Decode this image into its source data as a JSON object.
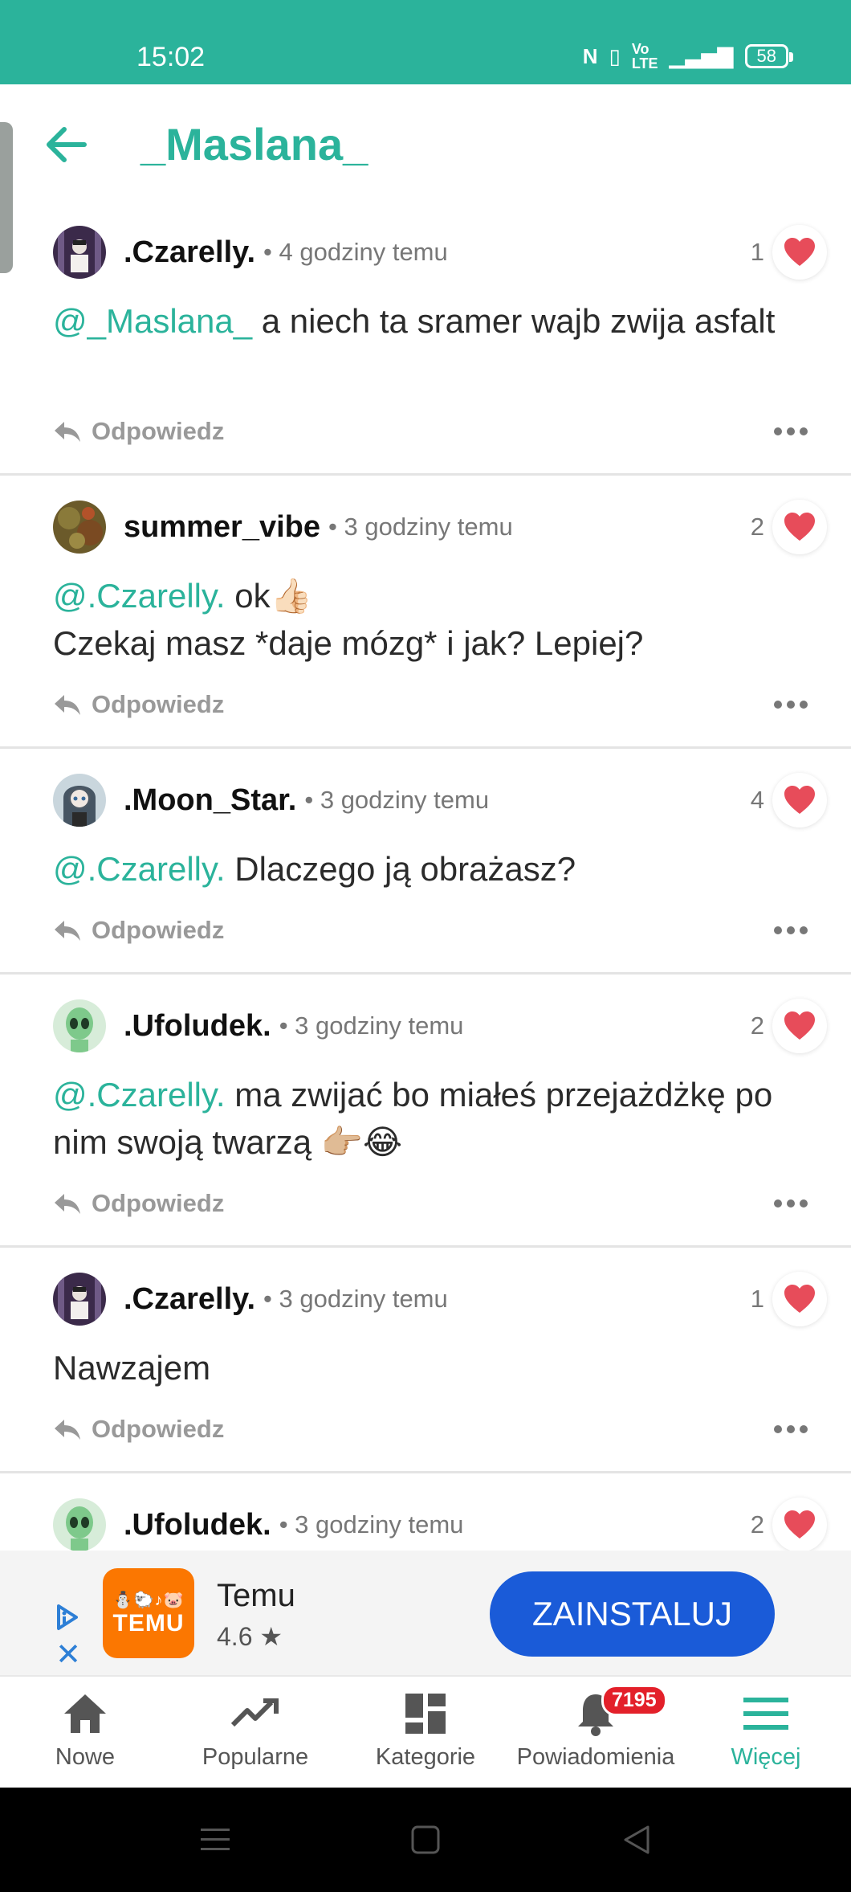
{
  "status_bar": {
    "time": "15:02",
    "battery": "58"
  },
  "header": {
    "title": "_Maslana_"
  },
  "comments": [
    {
      "username": ".Czarelly.",
      "meta": "• 4 godziny temu",
      "likes": "1",
      "mention": "@_Maslana_",
      "text": " a niech ta sramer wajb zwija asfalt",
      "reply_label": "Odpowiedz"
    },
    {
      "username": "summer_vibe",
      "meta": "• 3 godziny temu",
      "likes": "2",
      "mention": "@.Czarelly.",
      "text": " ok👍🏻\nCzekaj masz *daje mózg* i jak? Lepiej?",
      "reply_label": "Odpowiedz"
    },
    {
      "username": ".Moon_Star.",
      "meta": "• 3 godziny temu",
      "likes": "4",
      "mention": "@.Czarelly.",
      "text": " Dlaczego ją obrażasz?",
      "reply_label": "Odpowiedz"
    },
    {
      "username": ".Ufoludek.",
      "meta": "• 3 godziny temu",
      "likes": "2",
      "mention": "@.Czarelly.",
      "text": " ma zwijać bo miałeś przejażdżkę po nim swoją twarzą 👉🏼😂",
      "reply_label": "Odpowiedz"
    },
    {
      "username": ".Czarelly.",
      "meta": "• 3 godziny temu",
      "likes": "1",
      "mention": "",
      "text": "Nawzajem",
      "reply_label": "Odpowiedz"
    },
    {
      "username": ".Ufoludek.",
      "meta": "• 3 godziny temu",
      "likes": "2",
      "mention": "",
      "text": "",
      "reply_label": ""
    }
  ],
  "ad": {
    "logo_glyphs": "⛄🐑♪🐷",
    "logo_text": "TEMU",
    "name": "Temu",
    "rating": "4.6 ★",
    "install_label": "ZAINSTALUJ"
  },
  "nav": {
    "items": [
      {
        "label": "Nowe",
        "icon": "home-icon"
      },
      {
        "label": "Popularne",
        "icon": "trending-icon"
      },
      {
        "label": "Kategorie",
        "icon": "grid-icon"
      },
      {
        "label": "Powiadomienia",
        "icon": "bell-icon",
        "badge": "7195"
      },
      {
        "label": "Więcej",
        "icon": "menu-icon"
      }
    ],
    "active": "Więcej"
  },
  "colors": {
    "accent": "#2bb39b",
    "like": "#e74c5a",
    "badge": "#e3202a",
    "install": "#1a5bd8",
    "temu": "#fb7701"
  }
}
